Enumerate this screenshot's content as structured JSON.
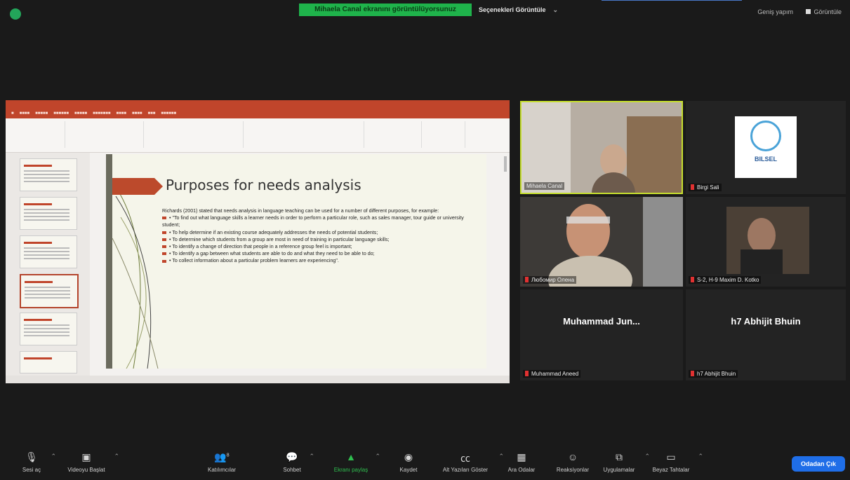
{
  "topbar": {
    "share_banner": "Mihaela Canal ekranını görüntülüyorsunuz",
    "view_options": "Seçenekleri Görüntüle",
    "exit_fullscreen": "Geniş yapım",
    "view": "Görüntüle"
  },
  "shared_screen": {
    "app": "PowerPoint",
    "slide_title": "Purposes for needs analysis",
    "slide_paragraphs": [
      "Richards (2001) stated that needs analysis in language teaching can be used for a number of different purposes, for example:",
      "• \"To find out what language skills a learner needs in order to perform a particular role, such as sales manager, tour guide or university student;",
      "• To help determine if an existing course adequately addresses the needs of potential students;",
      "• To determine which students from a group are most in need of training in particular language skills;",
      "• To identify a change of direction that people in a reference group feel is important;",
      "• To identify a gap between what students are able to do and what they need to be able to do;",
      "• To collect information about a particular problem learners are experiencing\"."
    ]
  },
  "participants": [
    {
      "name": "Mihaela Canal",
      "active_speaker": true
    },
    {
      "name": "Birgi Sali",
      "muted": true,
      "logo_text": "BILSEL"
    },
    {
      "name": "Любомир Олена",
      "muted": true
    },
    {
      "name": "S-2, H-9 Maxim D. Kotko",
      "muted": true
    },
    {
      "name": "Muhammad Aneed",
      "display": "Muhammad  Jun...",
      "muted": true
    },
    {
      "name": "h7 Abhijit Bhuin",
      "display": "h7 Abhijit Bhuin",
      "muted": true
    }
  ],
  "toolbar": {
    "items": [
      {
        "label": "Sesi aç",
        "icon": "microphone-muted-icon"
      },
      {
        "label": "Videoyu Başlat",
        "icon": "video-off-icon"
      },
      {
        "label": "Katılımcılar",
        "icon": "participants-icon",
        "count": "8"
      },
      {
        "label": "Sohbet",
        "icon": "chat-icon"
      },
      {
        "label": "Ekranı paylaş",
        "icon": "share-screen-icon"
      },
      {
        "label": "Kaydet",
        "icon": "record-icon"
      },
      {
        "label": "Alt Yazıları Göster",
        "icon": "captions-icon"
      },
      {
        "label": "Ara Odalar",
        "icon": "breakout-rooms-icon"
      },
      {
        "label": "Reaksiyonlar",
        "icon": "reactions-icon"
      },
      {
        "label": "Uygulamalar",
        "icon": "apps-icon"
      },
      {
        "label": "Beyaz Tahtalar",
        "icon": "whiteboard-icon"
      }
    ],
    "leave": "Odadan Çık"
  },
  "colors": {
    "accent_green": "#1fb34b",
    "leave_blue": "#1f6ee8",
    "speaker_border": "#c7e02f",
    "ppt_red": "#c0452b"
  }
}
